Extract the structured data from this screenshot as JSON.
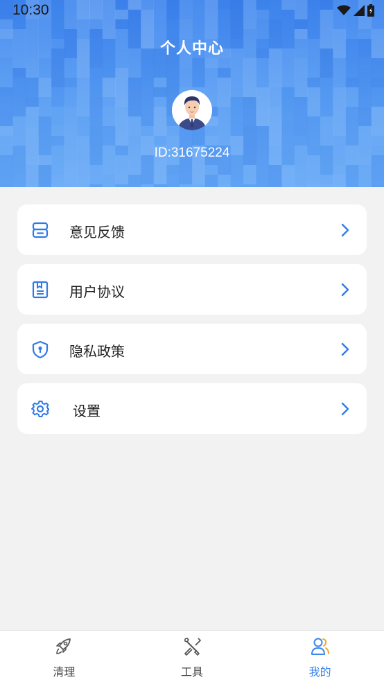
{
  "status_bar": {
    "time": "10:30",
    "icons": [
      "wifi-icon",
      "signal-icon",
      "battery-icon"
    ]
  },
  "header": {
    "title": "个人中心",
    "user_id": "ID:31675224",
    "avatar": "avatar-illustration"
  },
  "menu": {
    "items": [
      {
        "label": "意见反馈",
        "icon": "feedback-icon"
      },
      {
        "label": "用户协议",
        "icon": "document-icon"
      },
      {
        "label": "隐私政策",
        "icon": "shield-icon"
      },
      {
        "label": "设置",
        "icon": "gear-icon"
      }
    ]
  },
  "tabbar": {
    "tabs": [
      {
        "label": "清理",
        "icon": "rocket-icon",
        "active": false
      },
      {
        "label": "工具",
        "icon": "tools-icon",
        "active": false
      },
      {
        "label": "我的",
        "icon": "user-icon",
        "active": true
      }
    ]
  },
  "colors": {
    "accent": "#3a87ee",
    "header_top": "#3f86ee",
    "header_bottom": "#65a8f6",
    "background": "#f2f2f2"
  }
}
